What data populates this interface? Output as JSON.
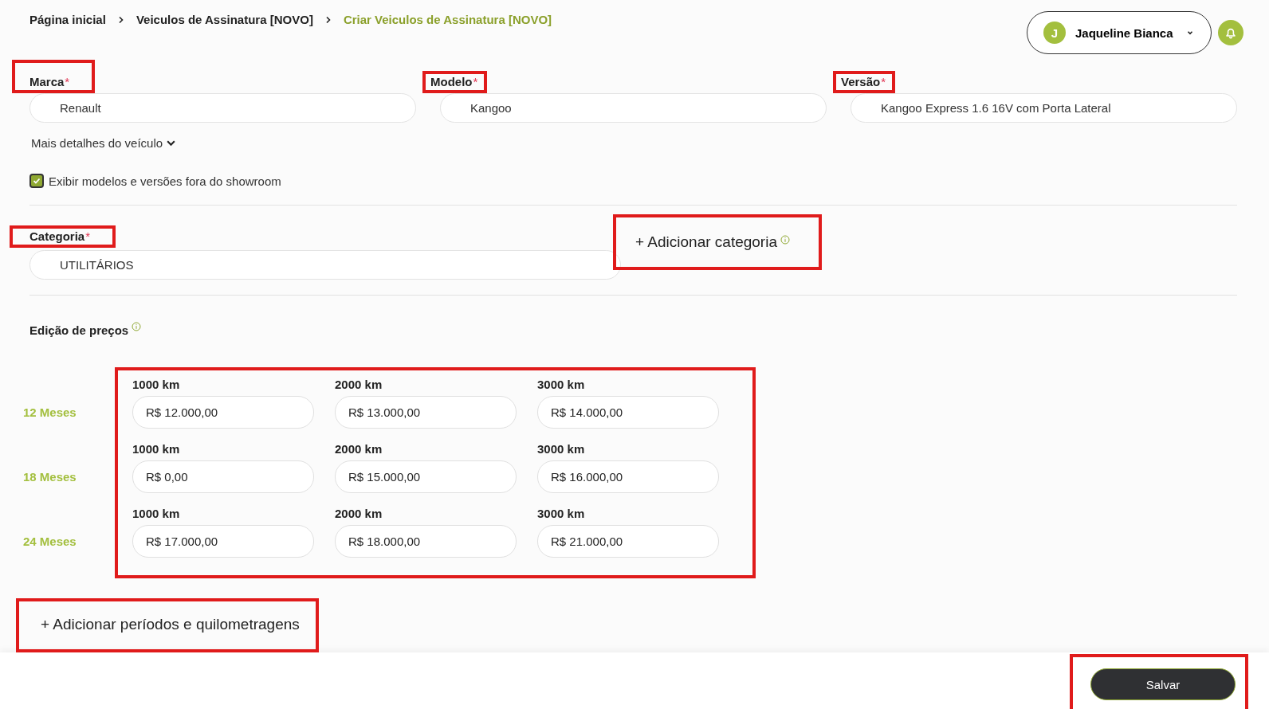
{
  "breadcrumb": [
    {
      "label": "Página inicial",
      "current": false
    },
    {
      "label": "Veiculos de Assinatura [NOVO]",
      "current": false
    },
    {
      "label": "Criar Veiculos de Assinatura [NOVO]",
      "current": true
    }
  ],
  "user": {
    "initial": "J",
    "name": "Jaqueline Bianca"
  },
  "vehicle_fields": [
    {
      "label": "Marca",
      "required_mark": "*",
      "value": "Renault",
      "highlighted": true
    },
    {
      "label": "Modelo",
      "required_mark": "*",
      "value": "Kangoo",
      "highlighted": true
    },
    {
      "label": "Versão",
      "required_mark": "*",
      "value": "Kangoo Express 1.6 16V com Porta Lateral",
      "highlighted": true
    }
  ],
  "details_toggle": {
    "label": "Mais detalhes do veículo"
  },
  "showroom_checkbox": {
    "label": "Exibir modelos e versões fora do showroom",
    "checked": true
  },
  "category": {
    "label": "Categoria",
    "required_mark": "*",
    "value": "UTILITÁRIOS",
    "highlighted": true
  },
  "add_category": {
    "label": "+ Adicionar categoria",
    "highlighted": true
  },
  "pricing": {
    "title": "Edição de preços",
    "highlighted": true,
    "periods": [
      {
        "label": "12 Meses",
        "prices": [
          {
            "mileage": "1000 km",
            "value": "R$ 12.000,00"
          },
          {
            "mileage": "2000 km",
            "value": "R$ 13.000,00"
          },
          {
            "mileage": "3000 km",
            "value": "R$ 14.000,00"
          }
        ]
      },
      {
        "label": "18 Meses",
        "prices": [
          {
            "mileage": "1000 km",
            "value": "R$ 0,00"
          },
          {
            "mileage": "2000 km",
            "value": "R$ 15.000,00"
          },
          {
            "mileage": "3000 km",
            "value": "R$ 16.000,00"
          }
        ]
      },
      {
        "label": "24 Meses",
        "prices": [
          {
            "mileage": "1000 km",
            "value": "R$ 17.000,00"
          },
          {
            "mileage": "2000 km",
            "value": "R$ 18.000,00"
          },
          {
            "mileage": "3000 km",
            "value": "R$ 21.000,00"
          }
        ]
      }
    ]
  },
  "add_periods": {
    "label": "+ Adicionar períodos e quilometragens",
    "highlighted": true
  },
  "save_button": {
    "label": "Salvar",
    "highlighted": true
  }
}
